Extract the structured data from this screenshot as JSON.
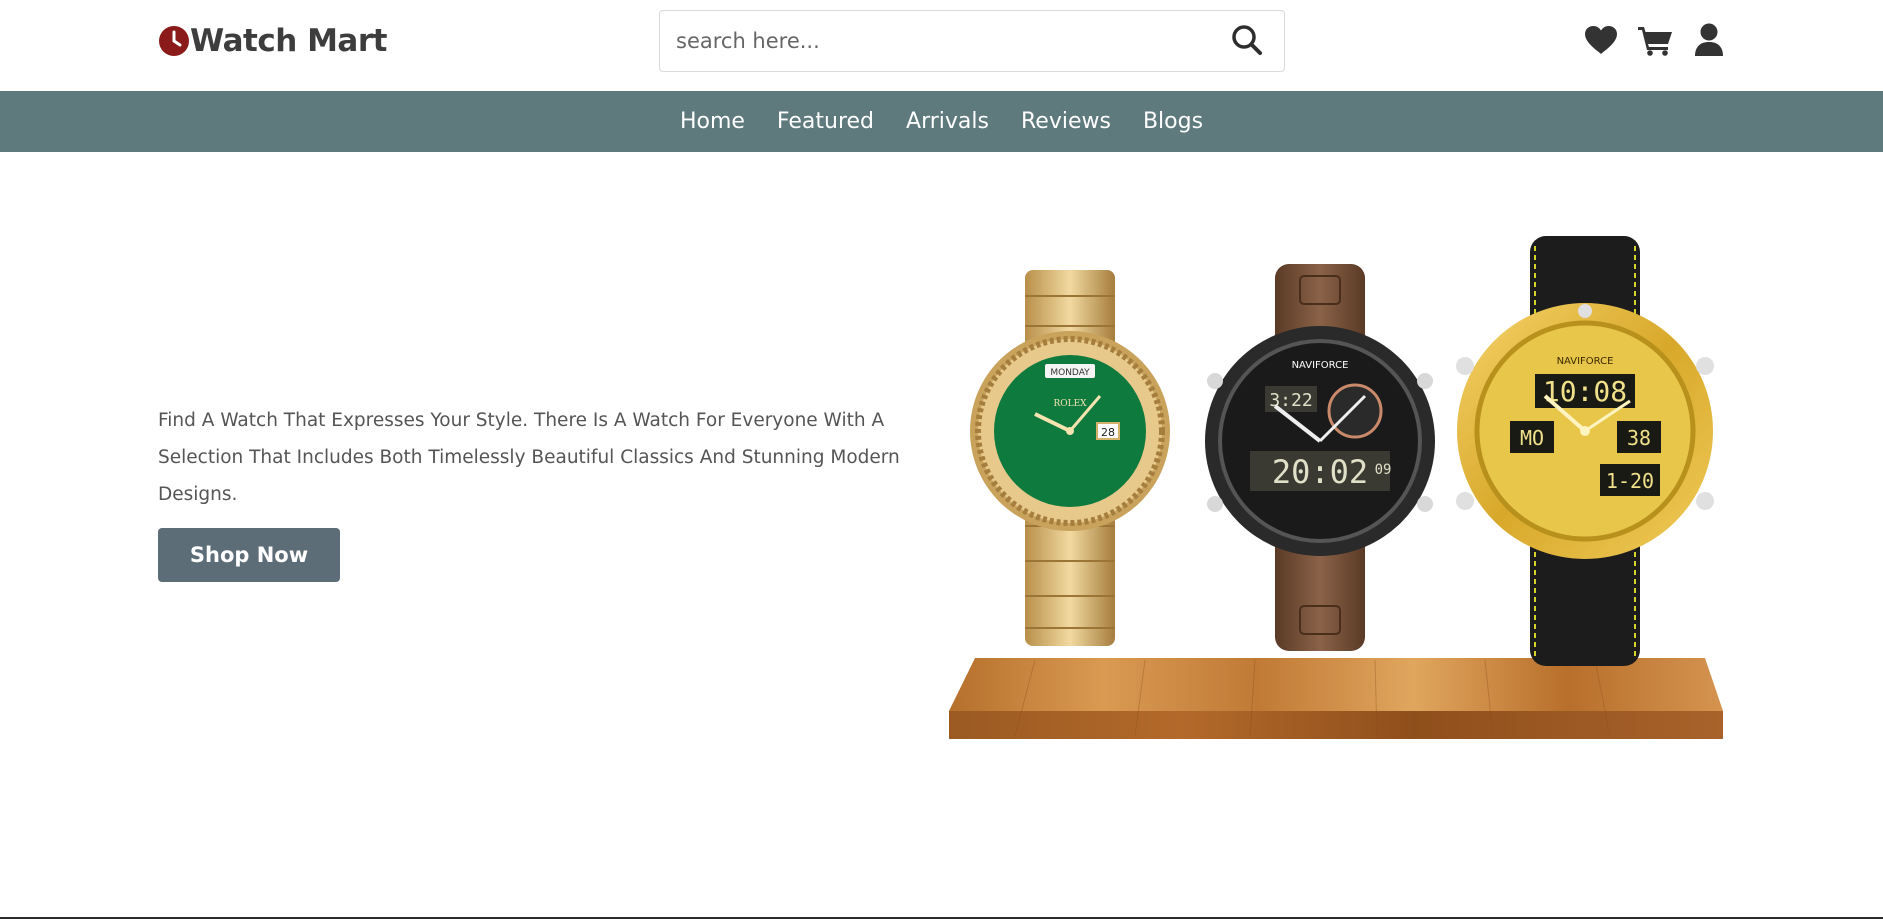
{
  "brand": {
    "name": "Watch Mart",
    "accent_color": "#8b1a1a",
    "icon": "clock-icon"
  },
  "search": {
    "placeholder": "search here...",
    "value": "",
    "icon": "search-icon"
  },
  "header_icons": [
    {
      "name": "heart-icon"
    },
    {
      "name": "cart-icon"
    },
    {
      "name": "user-icon"
    }
  ],
  "nav": {
    "background": "#5f7a7d",
    "items": [
      {
        "label": "Home"
      },
      {
        "label": "Featured"
      },
      {
        "label": "Arrivals"
      },
      {
        "label": "Reviews"
      },
      {
        "label": "Blogs"
      }
    ]
  },
  "hero": {
    "text": "Find A Watch That Expresses Your Style. There Is A Watch For Everyone With A Selection That Includes Both Timelessly Beautiful Classics And Stunning Modern Designs.",
    "button_label": "Shop Now",
    "button_color": "#5c6d78",
    "image": {
      "watches": [
        {
          "brand": "ROLEX",
          "day": "MONDAY",
          "date": "28"
        },
        {
          "brand": "NAVIFORCE",
          "time_top": "3:22",
          "time_main": "20:02",
          "seconds": "09"
        },
        {
          "brand": "NAVIFORCE",
          "time_top": "10:08",
          "day_num": "MO",
          "date_num": "38",
          "sub": "1-20"
        }
      ]
    }
  }
}
